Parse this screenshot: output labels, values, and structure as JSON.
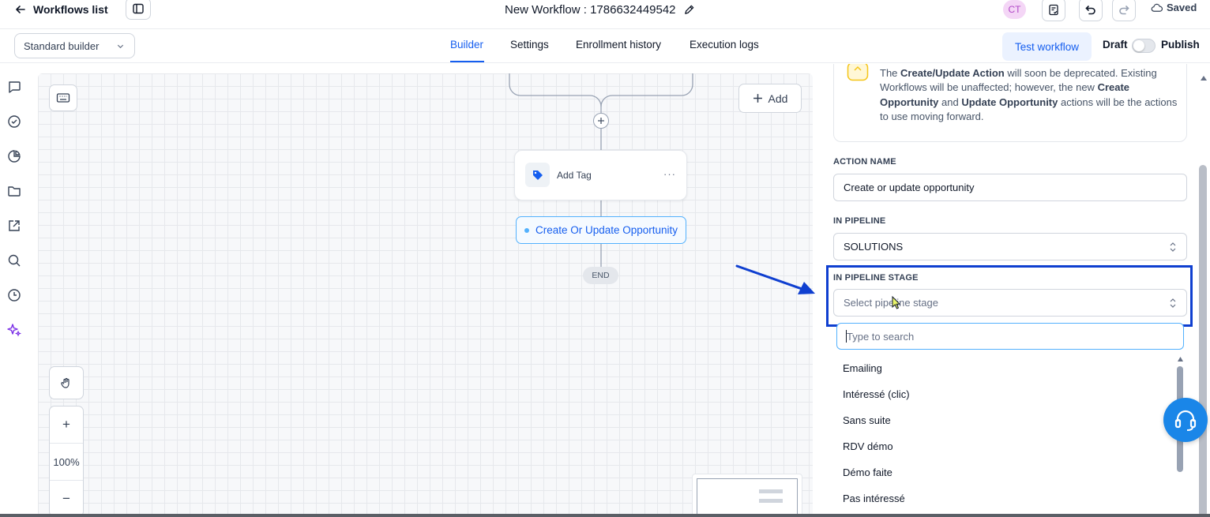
{
  "topbar": {
    "back_label": "Workflows list",
    "workflow_title": "New Workflow : 1786632449542",
    "avatar_initials": "CT",
    "saved_label": "Saved"
  },
  "subbar": {
    "builder_mode": "Standard builder",
    "tabs": [
      {
        "label": "Builder",
        "active": true
      },
      {
        "label": "Settings",
        "active": false
      },
      {
        "label": "Enrollment history",
        "active": false
      },
      {
        "label": "Execution logs",
        "active": false
      }
    ],
    "test_button": "Test workflow",
    "draft_label": "Draft",
    "publish_label": "Publish",
    "publish_toggle_on": false
  },
  "canvas": {
    "add_button": "Add",
    "zoom_level": "100%",
    "zoom_in": "+",
    "zoom_out": "−",
    "nodes": {
      "add_tag": "Add Tag",
      "node_menu": "···",
      "selected_action": "Create Or Update Opportunity",
      "end_label": "END"
    }
  },
  "panel": {
    "notice": {
      "p1": "The ",
      "b1": "Create/Update Action",
      "p2": " will soon be deprecated. Existing Workflows will be unaffected; however, the new ",
      "b2": "Create Opportunity",
      "p3": " and ",
      "b3": "Update Opportunity",
      "p4": " actions will be the actions to use moving forward."
    },
    "action_name_label": "ACTION NAME",
    "action_name_value": "Create or update opportunity",
    "pipeline_label": "IN PIPELINE",
    "pipeline_value": "SOLUTIONS",
    "stage_label": "IN PIPELINE STAGE",
    "stage_placeholder": "Select pipeline stage",
    "search_placeholder": "Type to search",
    "stage_options": [
      "Emailing",
      "Intéressé (clic)",
      "Sans suite",
      "RDV démo",
      "Démo faite",
      "Pas intéressé"
    ]
  },
  "colors": {
    "accent": "#155eef",
    "highlight_box": "#0f3fd0",
    "avatar_bg": "#f4d6f6",
    "support_button": "#1a86e8"
  }
}
